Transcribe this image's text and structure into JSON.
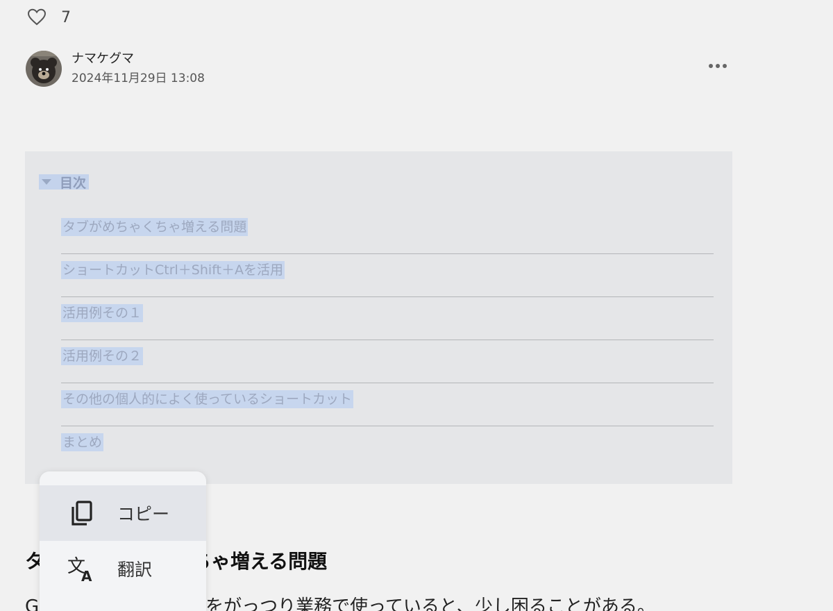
{
  "likes": {
    "count": "7"
  },
  "author": {
    "name": "ナマケグマ",
    "date": "2024年11月29日 13:08"
  },
  "toc": {
    "title": "目次",
    "items": [
      "タブがめちゃくちゃ増える問題",
      "ショートカットCtrl＋Shift＋Aを活用",
      "活用例その１",
      "活用例その２",
      "その他の個人的によく使っているショートカット",
      "まとめ"
    ]
  },
  "article": {
    "heading_visible": "ちゃ増える問題",
    "heading_left_fragment": "タ",
    "body_left_fragment": "G",
    "body_visible": "をがっつり業務で使っていると、少し困ることがある。"
  },
  "context_menu": {
    "items": [
      {
        "label": "コピー",
        "icon": "copy-icon"
      },
      {
        "label": "翻訳",
        "icon": "translate-icon"
      }
    ]
  },
  "colors": {
    "selection": "#c7d6ee",
    "toc_bg": "#e5e6e8",
    "page_bg": "#f1f1f1"
  }
}
